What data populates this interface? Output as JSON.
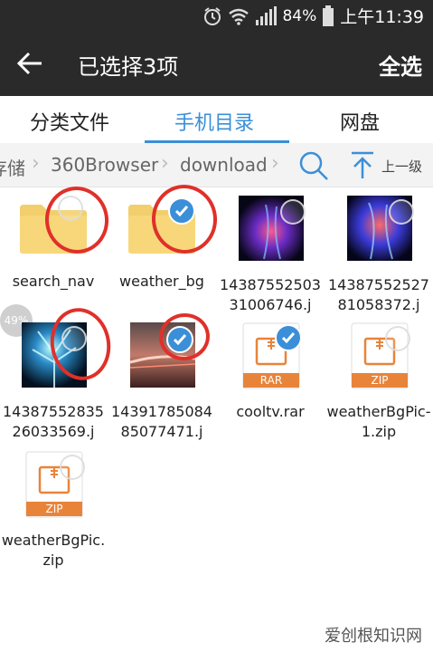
{
  "status_bar": {
    "battery_percent": "84%",
    "time": "上午11:39"
  },
  "app_bar": {
    "title": "已选择3项",
    "select_all": "全选"
  },
  "tabs": [
    {
      "label": "分类文件",
      "active": false
    },
    {
      "label": "手机目录",
      "active": true
    },
    {
      "label": "网盘",
      "active": false
    }
  ],
  "breadcrumb": {
    "items": [
      "存储",
      "360Browser",
      "download"
    ],
    "up_label": "上一级"
  },
  "files": [
    {
      "name": "search_nav",
      "type": "folder",
      "selected": false
    },
    {
      "name": "weather_bg",
      "type": "folder",
      "selected": true
    },
    {
      "name": "1438755250331006746.j",
      "type": "image",
      "selected": false
    },
    {
      "name": "1438755252781058372.j",
      "type": "image",
      "selected": false
    },
    {
      "name": "1438755283526033569.j",
      "type": "image",
      "selected": false,
      "progress": "49%"
    },
    {
      "name": "1439178508485077471.j",
      "type": "image",
      "selected": true
    },
    {
      "name": "cooltv.rar",
      "type": "archive",
      "archive_label": "RAR",
      "selected": true
    },
    {
      "name": "weatherBgPic-1.zip",
      "type": "archive",
      "archive_label": "ZIP",
      "selected": false
    },
    {
      "name": "weatherBgPic.zip",
      "type": "archive",
      "archive_label": "ZIP",
      "selected": false
    }
  ],
  "watermark": "爱创根知识网",
  "colors": {
    "accent": "#3b8fd8",
    "header": "#2a2a2a",
    "annotation": "#e0302a",
    "archive_band": "#e8843a",
    "folder": "#f7d77a"
  }
}
